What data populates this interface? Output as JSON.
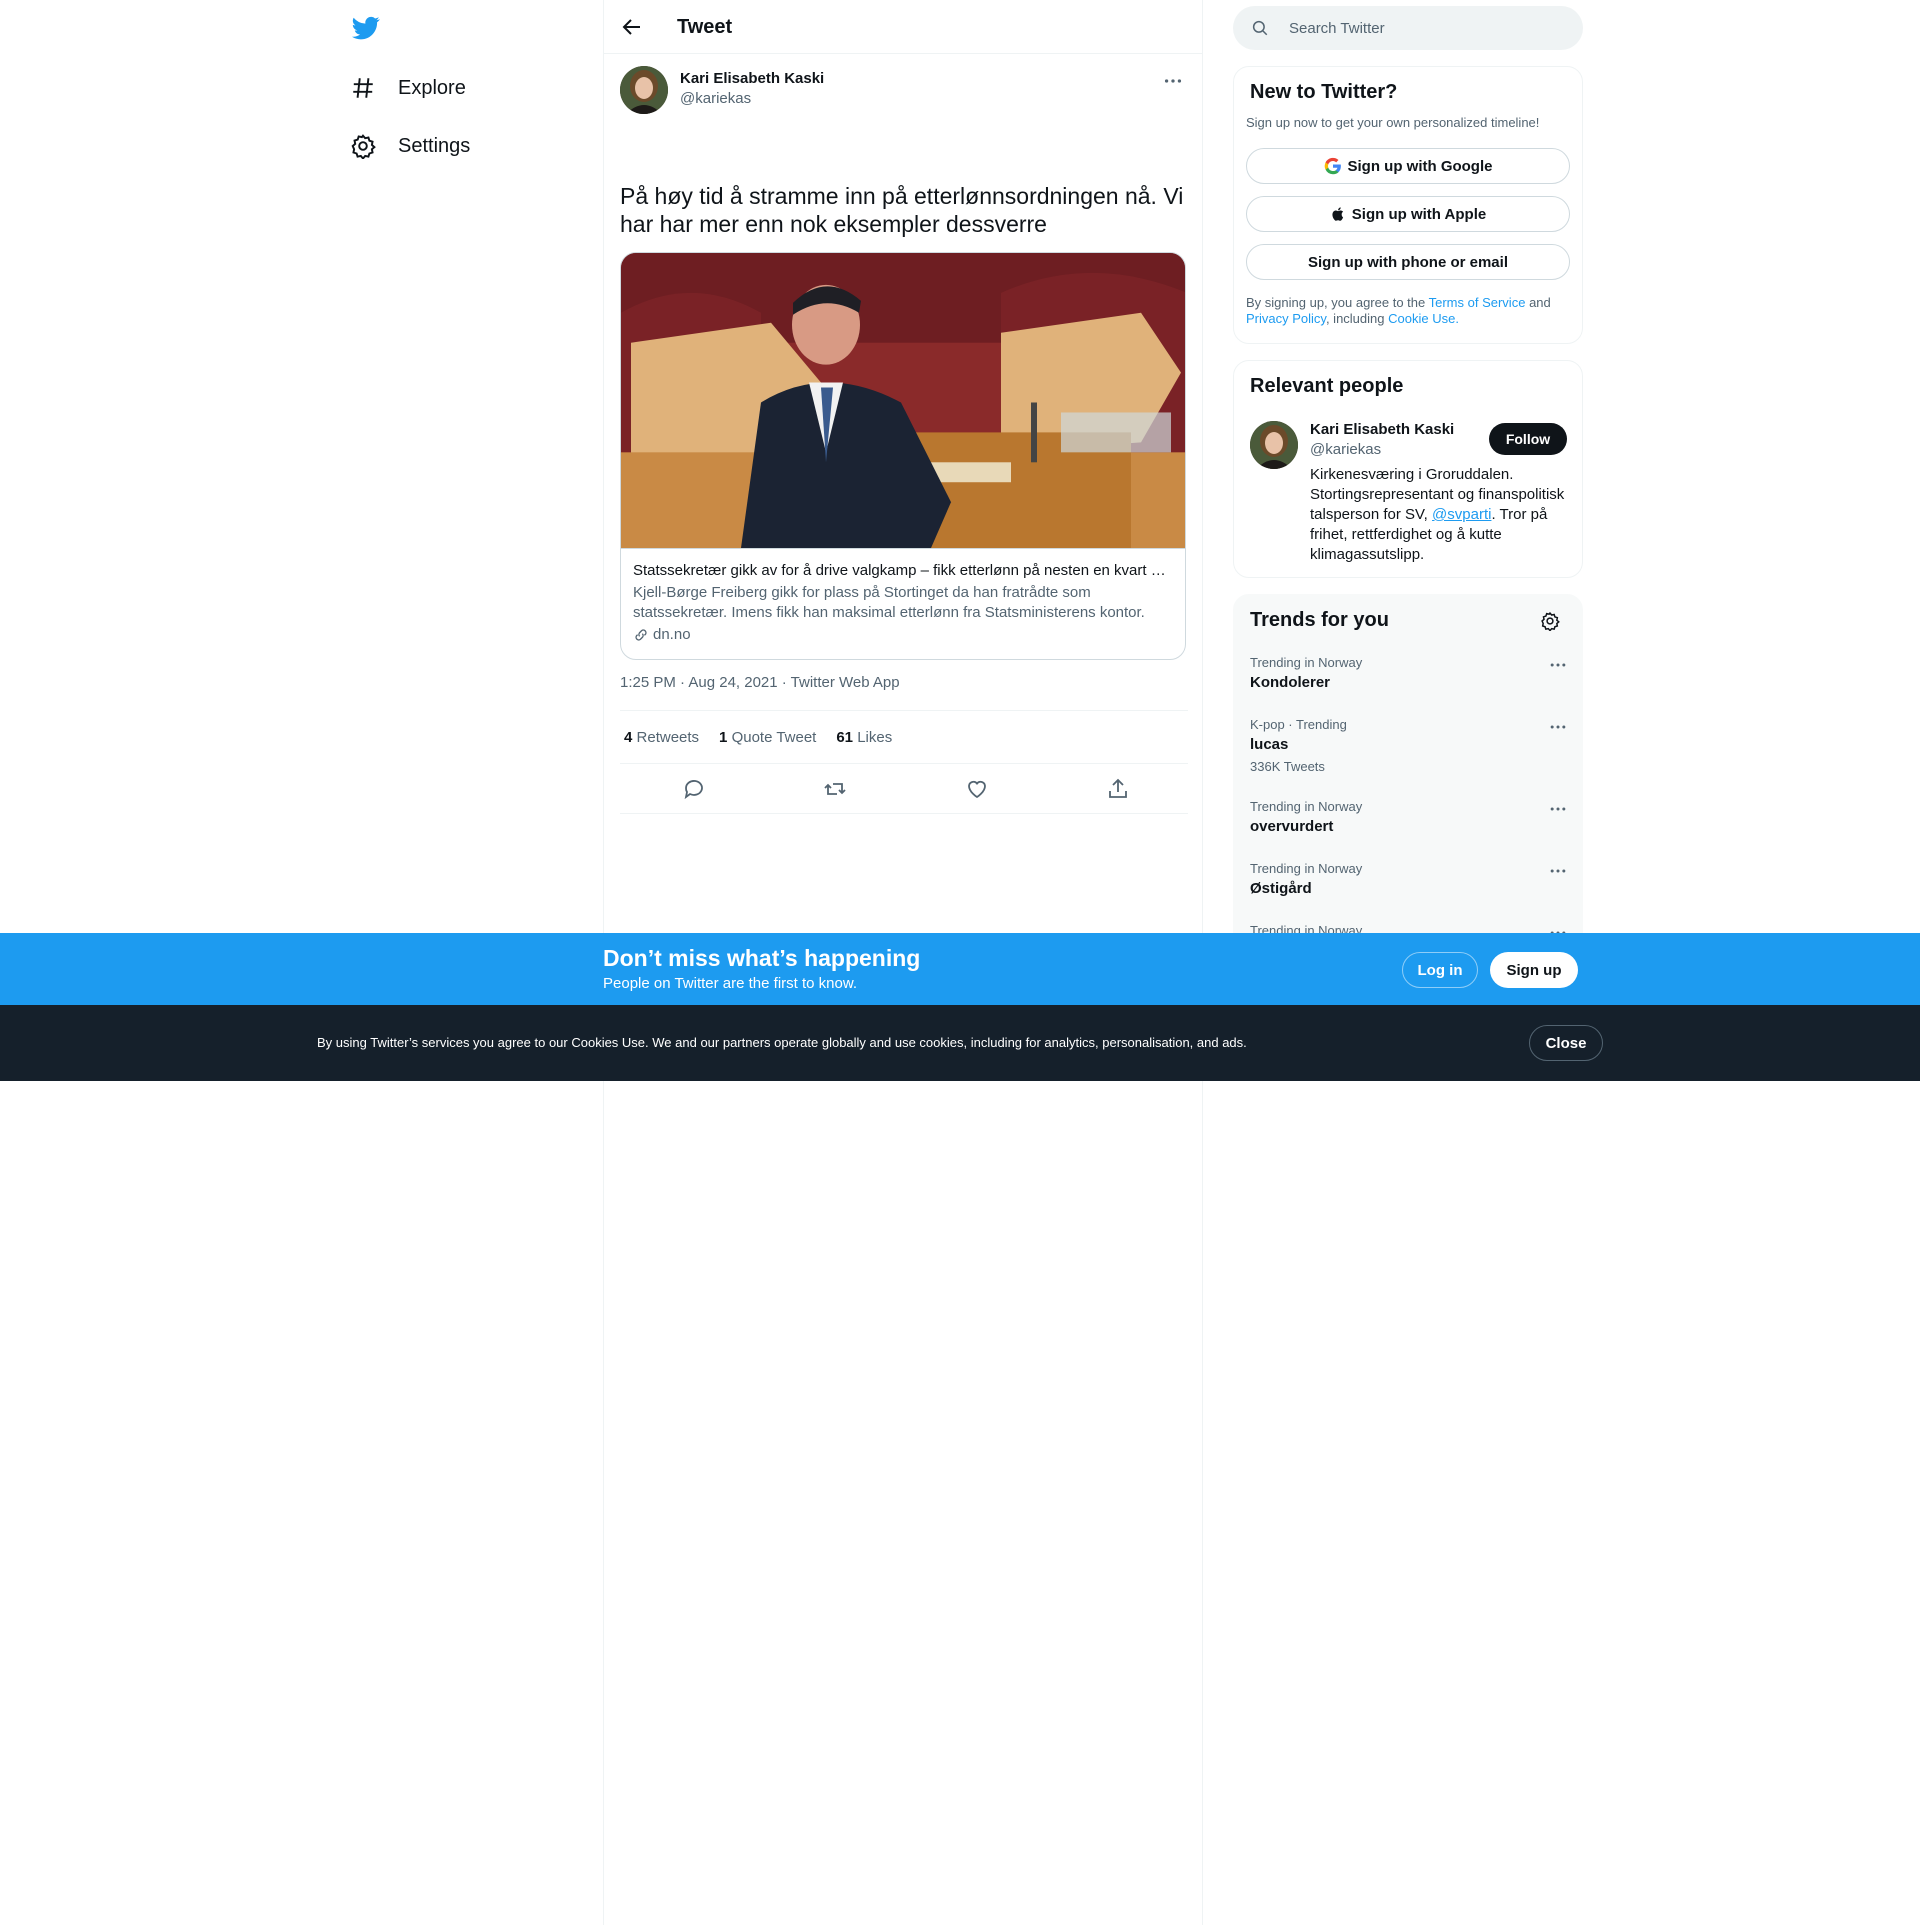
{
  "nav": {
    "items": [
      {
        "label": "Explore",
        "icon": "hashtag-icon"
      },
      {
        "label": "Settings",
        "icon": "gear-icon"
      }
    ]
  },
  "header": {
    "title": "Tweet"
  },
  "tweet": {
    "author_name": "Kari Elisabeth Kaski",
    "author_handle": "@kariekas",
    "text": "På høy tid å stramme inn på etterlønnsordningen nå. Vi har har mer enn nok eksempler dessverre",
    "card": {
      "title": "Statssekretær gikk av for å drive valgkamp – fikk etterlønn på nesten en kvart m...",
      "description": "Kjell-Børge Freiberg gikk for plass på Stortinget da han fratrådte som statssekretær. Imens fikk han maksimal etterlønn fra Statsministerens kontor.",
      "domain": "dn.no"
    },
    "timestamp": "1:25 PM · Aug 24, 2021 · Twitter Web App",
    "stats": {
      "retweets_count": "4",
      "retweets_label": "Retweets",
      "quotes_count": "1",
      "quotes_label": "Quote Tweet",
      "likes_count": "61",
      "likes_label": "Likes"
    }
  },
  "search": {
    "placeholder": "Search Twitter"
  },
  "new_to_twitter": {
    "title": "New to Twitter?",
    "subtitle": "Sign up now to get your own personalized timeline!",
    "google_label": "Sign up with Google",
    "apple_label": "Sign up with Apple",
    "phone_label": "Sign up with phone or email",
    "legal_pre": "By signing up, you agree to the",
    "terms": "Terms of Service",
    "and": "and",
    "privacy": "Privacy Policy",
    "including": ", including",
    "cookie_use": "Cookie Use."
  },
  "relevant_people": {
    "title": "Relevant people",
    "name": "Kari Elisabeth Kaski",
    "handle": "@kariekas",
    "follow_label": "Follow",
    "bio_pre": "Kirkenesværing i Groruddalen. Stortingsrepresentant og finanspolitisk talsperson for SV,",
    "bio_mention": "@svparti",
    "bio_post": ". Tror på frihet, rettferdighet og å kutte klimagassutslipp."
  },
  "trends": {
    "title": "Trends for you",
    "items": [
      {
        "meta": "Trending in Norway",
        "name": "Kondolerer",
        "count": ""
      },
      {
        "meta": "K-pop · Trending",
        "name": "lucas",
        "count": "336K Tweets"
      },
      {
        "meta": "Trending in Norway",
        "name": "overvurdert",
        "count": ""
      },
      {
        "meta": "Trending in Norway",
        "name": "Østigård",
        "count": ""
      },
      {
        "meta": "Trending in Norway",
        "name": "",
        "count": ""
      }
    ]
  },
  "banner": {
    "title": "Don’t miss what’s happening",
    "subtitle": "People on Twitter are the first to know.",
    "login_label": "Log in",
    "signup_label": "Sign up"
  },
  "cookie_bar": {
    "text": "By using Twitter’s services you agree to our Cookies Use. We and our partners operate globally and use cookies, including for analytics, personalisation, and ads.",
    "close_label": "Close"
  },
  "colors": {
    "accent": "#1d9bf0",
    "text_primary": "#0f1419",
    "text_secondary": "#536471",
    "cookie_bg": "#15202b"
  }
}
